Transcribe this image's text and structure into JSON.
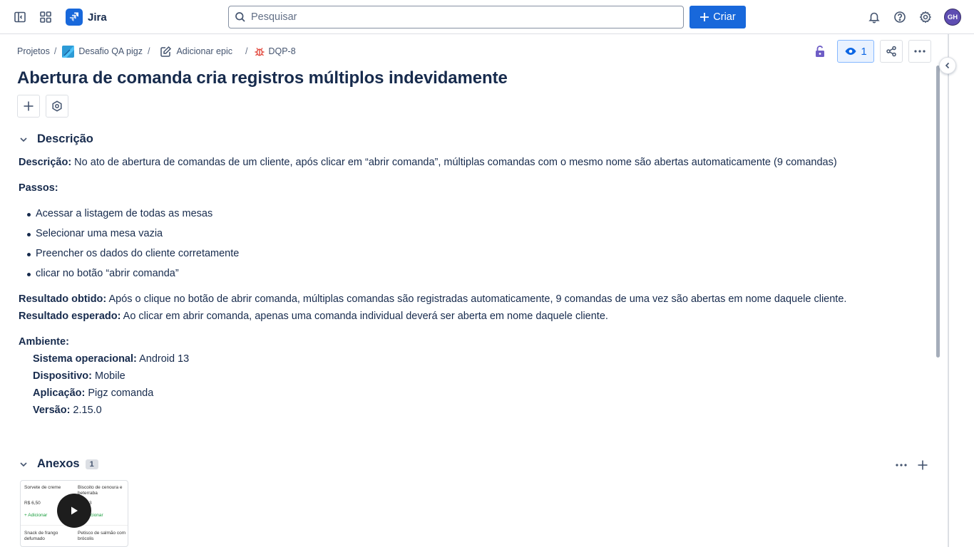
{
  "topbar": {
    "app_name": "Jira",
    "search_placeholder": "Pesquisar",
    "create_label": "Criar",
    "avatar_initials": "GH"
  },
  "breadcrumb": {
    "projects": "Projetos",
    "project": "Desafio QA pigz",
    "add_epic": "Adicionar epic",
    "issue_key": "DQP-8"
  },
  "issue": {
    "title": "Abertura de comanda cria registros múltiplos indevidamente",
    "watchers": "1"
  },
  "description": {
    "section_title": "Descrição",
    "desc_label": "Descrição:",
    "desc_text": " No ato de abertura de comandas de um cliente, após clicar em “abrir comanda”, múltiplas comandas com o mesmo nome são abertas automaticamente (9 comandas)",
    "steps_label": "Passos:",
    "steps": [
      "Acessar a listagem de todas as mesas",
      "Selecionar uma mesa vazia",
      "Preencher os dados do cliente corretamente",
      "clicar no botão “abrir comanda”"
    ],
    "obtained_label": "Resultado obtido:",
    "obtained_text": " Após o clique no botão de abrir comanda, múltiplas comandas são registradas automaticamente, 9 comandas de uma vez são abertas em nome daquele cliente.",
    "expected_label": "Resultado esperado:",
    "expected_text": " Ao clicar em abrir  comanda, apenas uma comanda individual deverá ser aberta em nome daquele cliente.",
    "env_label": "Ambiente:",
    "os_label": "Sistema operacional:",
    "os_value": " Android 13",
    "device_label": "Dispositivo:",
    "device_value": " Mobile",
    "app_label": "Aplicação:",
    "app_value": " Pigz comanda",
    "version_label": "Versão:",
    "version_value": " 2.15.0"
  },
  "attachments": {
    "section_title": "Anexos",
    "count": "1",
    "thumb": {
      "item1": "Sorvete de creme",
      "item2": "Biscoito de cenoura e beterraba",
      "price1": "R$ 6,50",
      "price2": "3",
      "add1": "+ Adicionar",
      "add2": "cionar",
      "item3": "Snack de frango defumado",
      "item4": "Petisco de salmão com brócolis"
    }
  },
  "colors": {
    "accent": "#1868db",
    "text": "#172b4d",
    "bug_red": "#e2483d",
    "lock_purple": "#6e5dc6"
  }
}
